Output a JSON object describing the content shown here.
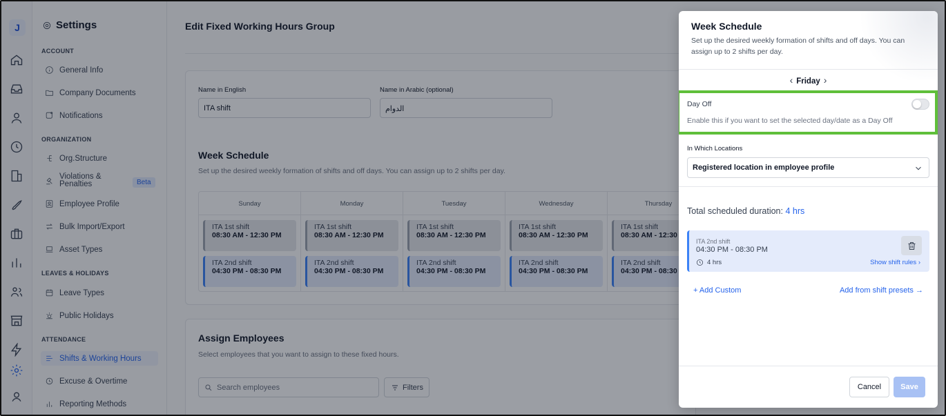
{
  "rail": {
    "logo": "J"
  },
  "settings_nav": {
    "title": "Settings",
    "sections": [
      {
        "label": "ACCOUNT",
        "items": [
          "General Info",
          "Company Documents",
          "Notifications"
        ]
      },
      {
        "label": "ORGANIZATION",
        "items": [
          "Org.Structure",
          "Violations & Penalties",
          "Employee Profile",
          "Bulk Import/Export",
          "Asset Types"
        ]
      },
      {
        "label": "LEAVES & HOLIDAYS",
        "items": [
          "Leave Types",
          "Public Holidays"
        ]
      },
      {
        "label": "ATTENDANCE",
        "items": [
          "Shifts & Working Hours",
          "Excuse & Overtime",
          "Reporting Methods"
        ]
      }
    ],
    "beta_badge": "Beta",
    "active_item": "Shifts & Working Hours"
  },
  "main": {
    "title": "Edit Fixed Working Hours Group",
    "name_en_label": "Name in English",
    "name_en_value": "ITA shift",
    "name_ar_label": "Name in Arabic (optional)",
    "name_ar_value": "الدوام",
    "week_schedule_title": "Week Schedule",
    "week_schedule_desc": "Set up the desired weekly formation of shifts and off days. You can assign up to 2 shifts per day.",
    "days": [
      "Sunday",
      "Monday",
      "Tuesday",
      "Wednesday",
      "Thursday"
    ],
    "shift1": {
      "name": "ITA 1st shift",
      "time": "08:30 AM - 12:30 PM"
    },
    "shift2": {
      "name": "ITA 2nd shift",
      "time": "04:30 PM - 08:30 PM"
    },
    "assign_title": "Assign Employees",
    "assign_desc": "Select employees that you want to assign to these fixed hours.",
    "search_placeholder": "Search employees",
    "filters_label": "Filters"
  },
  "modal": {
    "title": "Week Schedule",
    "desc": "Set up the desired weekly formation of shifts and off days. You can assign up to 2 shifts per day.",
    "day": "Friday",
    "day_off_title": "Day Off",
    "day_off_desc": "Enable this if you want to set the selected day/date as a Day Off",
    "day_off_enabled": false,
    "locations_label": "In Which Locations",
    "locations_value": "Registered location in employee profile",
    "total_label": "Total scheduled duration:",
    "total_value": "4 hrs",
    "shift": {
      "name": "ITA 2nd shift",
      "time": "04:30 PM - 08:30 PM",
      "duration": "4 hrs",
      "rules_link": "Show shift rules"
    },
    "add_custom": "Add Custom",
    "add_presets": "Add from shift presets",
    "cancel": "Cancel",
    "save": "Save"
  },
  "colors": {
    "accent": "#2563eb",
    "highlight": "#5fbf3a",
    "save_disabled": "#a8c1f4"
  }
}
